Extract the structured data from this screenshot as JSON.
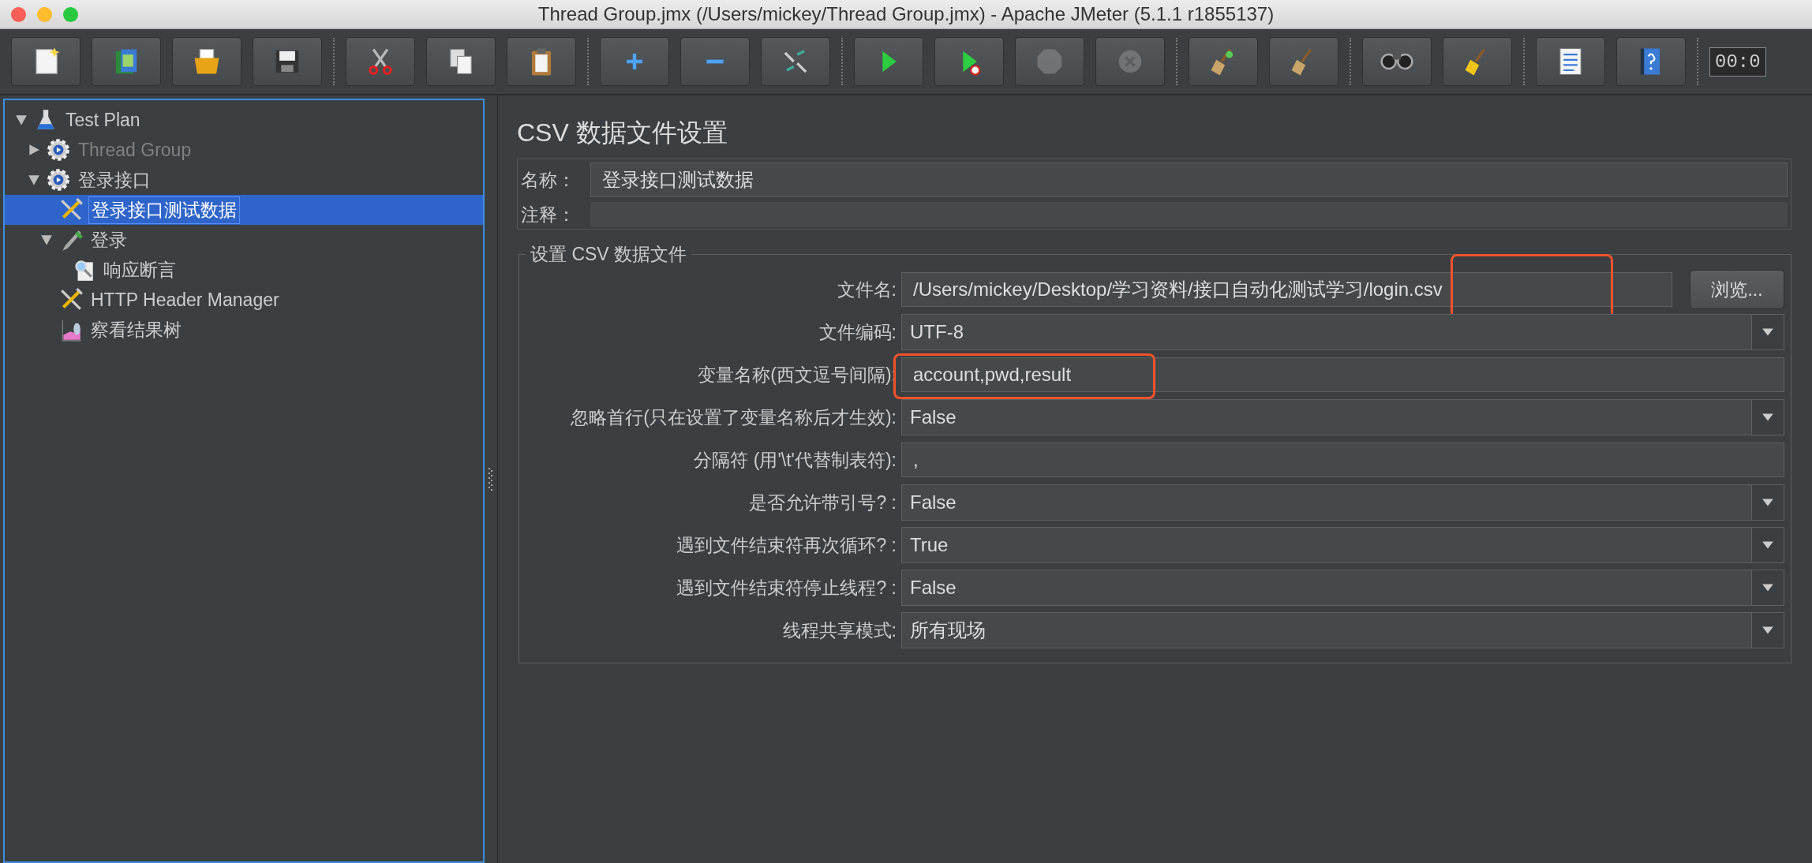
{
  "window": {
    "title": "Thread Group.jmx (/Users/mickey/Thread Group.jmx) - Apache JMeter (5.1.1 r1855137)"
  },
  "toolbar": {
    "groups": [
      [
        {
          "kind": "new",
          "disabled": false
        },
        {
          "kind": "templates",
          "disabled": false
        },
        {
          "kind": "open",
          "disabled": false
        },
        {
          "kind": "save",
          "disabled": false
        }
      ],
      [
        {
          "kind": "cut",
          "disabled": false
        },
        {
          "kind": "copy",
          "disabled": false
        },
        {
          "kind": "paste",
          "disabled": false
        }
      ],
      [
        {
          "kind": "expand",
          "disabled": false
        },
        {
          "kind": "collapse",
          "disabled": false
        },
        {
          "kind": "toggle",
          "disabled": false
        }
      ],
      [
        {
          "kind": "start",
          "disabled": false
        },
        {
          "kind": "start_no_pause",
          "disabled": false
        },
        {
          "kind": "stop",
          "disabled": true
        },
        {
          "kind": "shutdown",
          "disabled": true
        }
      ],
      [
        {
          "kind": "clear",
          "disabled": false
        },
        {
          "kind": "clear_all",
          "disabled": false
        }
      ],
      [
        {
          "kind": "search",
          "disabled": false
        },
        {
          "kind": "reset_search",
          "disabled": false
        }
      ],
      [
        {
          "kind": "function_helper",
          "disabled": false
        },
        {
          "kind": "help",
          "disabled": false
        }
      ]
    ],
    "timer": "00:0"
  },
  "tree": [
    {
      "label": "Test Plan",
      "kind": "plan",
      "expanded": true,
      "selected": false,
      "disabled": false,
      "children": [
        {
          "label": "Thread Group",
          "kind": "thread",
          "expanded": false,
          "selected": false,
          "disabled": true
        },
        {
          "label": "登录接口",
          "kind": "thread",
          "expanded": true,
          "selected": false,
          "disabled": false,
          "children": [
            {
              "label": "登录接口测试数据",
              "kind": "config",
              "selected": true,
              "disabled": false
            },
            {
              "label": "登录",
              "kind": "sampler",
              "expanded": true,
              "selected": false,
              "disabled": false,
              "children": [
                {
                  "label": "响应断言",
                  "kind": "assertion",
                  "selected": false,
                  "disabled": false
                }
              ]
            },
            {
              "label": "HTTP Header Manager",
              "kind": "config",
              "selected": false,
              "disabled": false
            },
            {
              "label": "察看结果树",
              "kind": "listener",
              "selected": false,
              "disabled": false
            }
          ]
        }
      ]
    }
  ],
  "panel": {
    "title": "CSV 数据文件设置",
    "name_field": {
      "label": "名称：",
      "value": "登录接口测试数据"
    },
    "comment_field": {
      "label": "注释："
    },
    "group": {
      "title": "设置 CSV 数据文件",
      "fields": [
        {
          "kind": "file",
          "label": "文件名:",
          "value": "/Users/mickey/Desktop/学习资料/接口自动化测试学习/login.csv",
          "button": "浏览...",
          "highlighted": true
        },
        {
          "kind": "dropdown",
          "label": "文件编码:",
          "value": "UTF-8",
          "highlighted": false
        },
        {
          "kind": "text",
          "label": "变量名称(西文逗号间隔):",
          "value": "account,pwd,result",
          "highlighted": true
        },
        {
          "kind": "dropdown",
          "label": "忽略首行(只在设置了变量名称后才生效):",
          "value": "False",
          "highlighted": false
        },
        {
          "kind": "text",
          "label": "分隔符 (用'\\t'代替制表符):",
          "value": ",",
          "highlighted": false
        },
        {
          "kind": "dropdown",
          "label": "是否允许带引号? :",
          "value": "False",
          "highlighted": false
        },
        {
          "kind": "dropdown",
          "label": "遇到文件结束符再次循环? :",
          "value": "True",
          "highlighted": false
        },
        {
          "kind": "dropdown",
          "label": "遇到文件结束符停止线程? :",
          "value": "False",
          "highlighted": false
        },
        {
          "kind": "dropdown",
          "label": "线程共享模式:",
          "value": "所有现场",
          "highlighted": false
        }
      ]
    }
  }
}
